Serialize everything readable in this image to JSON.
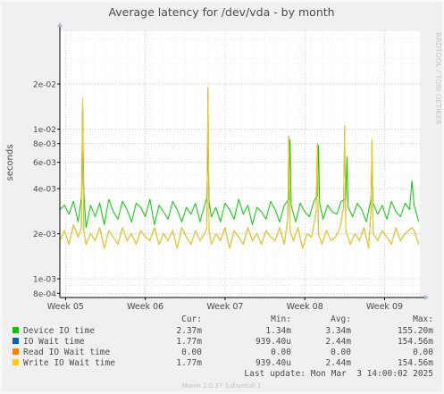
{
  "chart_data": {
    "type": "line",
    "title": "Average latency for /dev/vda - by month",
    "ylabel": "seconds",
    "watermark": "RRDTOOL / TOBI OETIKER",
    "yscale": "log",
    "ylim": [
      0.00075,
      0.045
    ],
    "xlim": [
      0,
      31.6
    ],
    "yticks": [
      {
        "v": 0.0008,
        "label": "8e-04"
      },
      {
        "v": 0.001,
        "label": "1e-03"
      },
      {
        "v": 0.002,
        "label": "2e-03"
      },
      {
        "v": 0.004,
        "label": "4e-03"
      },
      {
        "v": 0.006,
        "label": "6e-03"
      },
      {
        "v": 0.008,
        "label": "8e-03"
      },
      {
        "v": 0.01,
        "label": "1e-02"
      },
      {
        "v": 0.02,
        "label": "2e-02"
      }
    ],
    "xticks": [
      {
        "v": 0.5,
        "label": "Week 05"
      },
      {
        "v": 7.5,
        "label": "Week 06"
      },
      {
        "v": 14.5,
        "label": "Week 07"
      },
      {
        "v": 21.5,
        "label": "Week 08"
      },
      {
        "v": 28.5,
        "label": "Week 09"
      }
    ],
    "grid": true,
    "series": [
      {
        "name": "Device IO time",
        "color": "#00cc00",
        "x": [
          0,
          0.4,
          0.8,
          1.2,
          1.6,
          1.9,
          2.0,
          2.1,
          2.3,
          2.7,
          3.1,
          3.5,
          3.9,
          4.3,
          4.7,
          5.1,
          5.5,
          5.9,
          6.3,
          6.7,
          7.1,
          7.5,
          7.9,
          8.3,
          8.7,
          9.1,
          9.5,
          9.9,
          10.3,
          10.7,
          11.1,
          11.5,
          11.9,
          12.3,
          12.7,
          12.9,
          13.0,
          13.1,
          13.3,
          13.7,
          14.1,
          14.5,
          14.9,
          15.3,
          15.7,
          16.1,
          16.5,
          16.9,
          17.3,
          17.7,
          18.1,
          18.5,
          18.9,
          19.3,
          19.7,
          20.1,
          20.2,
          20.3,
          20.7,
          21.1,
          21.5,
          21.9,
          22.3,
          22.6,
          22.7,
          22.8,
          23.1,
          23.5,
          23.9,
          24.3,
          24.7,
          25.1,
          25.2,
          25.3,
          25.7,
          26.1,
          26.5,
          26.9,
          27.3,
          27.4,
          27.5,
          27.9,
          28.3,
          28.7,
          29.1,
          29.5,
          29.9,
          30.3,
          30.7,
          30.9,
          31.1,
          31.5
        ],
        "values": [
          0.0029,
          0.0031,
          0.0027,
          0.0033,
          0.0024,
          0.0035,
          0.015,
          0.0038,
          0.0022,
          0.0031,
          0.0026,
          0.0032,
          0.0023,
          0.0034,
          0.0028,
          0.0025,
          0.0033,
          0.0029,
          0.0024,
          0.0032,
          0.003,
          0.0026,
          0.0034,
          0.0023,
          0.0031,
          0.0028,
          0.0025,
          0.0033,
          0.0029,
          0.0024,
          0.003,
          0.0027,
          0.0032,
          0.0024,
          0.0031,
          0.0035,
          0.007,
          0.0033,
          0.0026,
          0.003,
          0.0024,
          0.0032,
          0.0029,
          0.0025,
          0.0034,
          0.0027,
          0.0031,
          0.0023,
          0.003,
          0.0028,
          0.0025,
          0.0033,
          0.0029,
          0.0024,
          0.0031,
          0.0034,
          0.0085,
          0.0031,
          0.0024,
          0.0032,
          0.0028,
          0.0026,
          0.0033,
          0.0036,
          0.0078,
          0.0032,
          0.0025,
          0.0031,
          0.0028,
          0.0027,
          0.0033,
          0.0034,
          0.0065,
          0.003,
          0.0026,
          0.0032,
          0.0029,
          0.0024,
          0.0034,
          0.006,
          0.0032,
          0.0027,
          0.0031,
          0.0025,
          0.0033,
          0.0028,
          0.0026,
          0.0032,
          0.0029,
          0.0045,
          0.0031,
          0.0024
        ]
      },
      {
        "name": "IO Wait time",
        "color": "#0066b3",
        "x": [
          0,
          0.4,
          0.8,
          1.2,
          1.6,
          1.9,
          2.0,
          2.1,
          2.3,
          2.7,
          3.1,
          3.5,
          3.9,
          4.3,
          4.7,
          5.1,
          5.5,
          5.9,
          6.3,
          6.7,
          7.1,
          7.5,
          7.9,
          8.3,
          8.7,
          9.1,
          9.5,
          9.9,
          10.3,
          10.7,
          11.1,
          11.5,
          11.9,
          12.3,
          12.7,
          12.9,
          13.0,
          13.1,
          13.3,
          13.7,
          14.1,
          14.5,
          14.9,
          15.3,
          15.7,
          16.1,
          16.5,
          16.9,
          17.3,
          17.7,
          18.1,
          18.5,
          18.9,
          19.3,
          19.7,
          20.0,
          20.1,
          20.2,
          20.5,
          20.9,
          21.3,
          21.7,
          22.1,
          22.5,
          22.6,
          22.7,
          23.0,
          23.4,
          23.8,
          24.2,
          24.6,
          24.9,
          25.0,
          25.1,
          25.5,
          25.9,
          26.3,
          26.7,
          27.1,
          27.3,
          27.4,
          27.5,
          27.9,
          28.3,
          28.7,
          29.1,
          29.5,
          29.9,
          30.3,
          30.9,
          31.1,
          31.5
        ],
        "values": [
          0.0018,
          0.0021,
          0.0017,
          0.0023,
          0.0019,
          0.0022,
          0.016,
          0.0021,
          0.0017,
          0.002,
          0.0018,
          0.0022,
          0.0016,
          0.0021,
          0.0019,
          0.0017,
          0.0022,
          0.0018,
          0.002,
          0.0017,
          0.0021,
          0.0019,
          0.0018,
          0.0022,
          0.0017,
          0.002,
          0.0018,
          0.0021,
          0.0016,
          0.0022,
          0.0019,
          0.0017,
          0.0021,
          0.0018,
          0.002,
          0.0022,
          0.019,
          0.0021,
          0.0017,
          0.002,
          0.0018,
          0.0022,
          0.0016,
          0.0021,
          0.0019,
          0.0017,
          0.0022,
          0.0018,
          0.002,
          0.0017,
          0.0021,
          0.0019,
          0.0018,
          0.0022,
          0.0017,
          0.0025,
          0.009,
          0.0021,
          0.0018,
          0.0022,
          0.0016,
          0.002,
          0.0019,
          0.0028,
          0.008,
          0.002,
          0.0017,
          0.0021,
          0.0018,
          0.0019,
          0.0022,
          0.003,
          0.0105,
          0.0021,
          0.0017,
          0.002,
          0.0018,
          0.0022,
          0.0016,
          0.0028,
          0.0085,
          0.002,
          0.0018,
          0.0021,
          0.0019,
          0.0017,
          0.0022,
          0.0018,
          0.002,
          0.0022,
          0.0021,
          0.0017
        ]
      },
      {
        "name": "Read IO Wait time",
        "color": "#ff8000",
        "x": [
          0,
          31.6
        ],
        "values": [
          0,
          0
        ]
      },
      {
        "name": "Write IO Wait time",
        "color": "#ffcc00",
        "x": [
          0,
          0.4,
          0.8,
          1.2,
          1.6,
          1.9,
          2.0,
          2.1,
          2.3,
          2.7,
          3.1,
          3.5,
          3.9,
          4.3,
          4.7,
          5.1,
          5.5,
          5.9,
          6.3,
          6.7,
          7.1,
          7.5,
          7.9,
          8.3,
          8.7,
          9.1,
          9.5,
          9.9,
          10.3,
          10.7,
          11.1,
          11.5,
          11.9,
          12.3,
          12.7,
          12.9,
          13.0,
          13.1,
          13.3,
          13.7,
          14.1,
          14.5,
          14.9,
          15.3,
          15.7,
          16.1,
          16.5,
          16.9,
          17.3,
          17.7,
          18.1,
          18.5,
          18.9,
          19.3,
          19.7,
          20.0,
          20.1,
          20.2,
          20.5,
          20.9,
          21.3,
          21.7,
          22.1,
          22.5,
          22.6,
          22.7,
          23.0,
          23.4,
          23.8,
          24.2,
          24.6,
          24.9,
          25.0,
          25.1,
          25.5,
          25.9,
          26.3,
          26.7,
          27.1,
          27.3,
          27.4,
          27.5,
          27.9,
          28.3,
          28.7,
          29.1,
          29.5,
          29.9,
          30.3,
          30.9,
          31.1,
          31.5
        ],
        "values": [
          0.0018,
          0.0021,
          0.0017,
          0.0023,
          0.0019,
          0.0022,
          0.016,
          0.0021,
          0.0017,
          0.002,
          0.0018,
          0.0022,
          0.0016,
          0.0021,
          0.0019,
          0.0017,
          0.0022,
          0.0018,
          0.002,
          0.0017,
          0.0021,
          0.0019,
          0.0018,
          0.0022,
          0.0017,
          0.002,
          0.0018,
          0.0021,
          0.0016,
          0.0022,
          0.0019,
          0.0017,
          0.0021,
          0.0018,
          0.002,
          0.0022,
          0.019,
          0.0021,
          0.0017,
          0.002,
          0.0018,
          0.0022,
          0.0016,
          0.0021,
          0.0019,
          0.0017,
          0.0022,
          0.0018,
          0.002,
          0.0017,
          0.0021,
          0.0019,
          0.0018,
          0.0022,
          0.0017,
          0.0025,
          0.009,
          0.0021,
          0.0018,
          0.0022,
          0.0016,
          0.002,
          0.0019,
          0.0028,
          0.008,
          0.002,
          0.0017,
          0.0021,
          0.0018,
          0.0019,
          0.0022,
          0.003,
          0.0105,
          0.0021,
          0.0017,
          0.002,
          0.0018,
          0.0022,
          0.0016,
          0.0028,
          0.0085,
          0.002,
          0.0018,
          0.0021,
          0.0019,
          0.0017,
          0.0022,
          0.0018,
          0.002,
          0.0022,
          0.0021,
          0.0017
        ]
      }
    ],
    "legend": {
      "headers": [
        "Cur:",
        "Min:",
        "Avg:",
        "Max:"
      ],
      "rows": [
        {
          "name": "Device IO time",
          "color": "#00cc00",
          "cur": "2.37m",
          "min": "1.34m",
          "avg": "3.34m",
          "max": "155.20m"
        },
        {
          "name": "IO Wait time",
          "color": "#0066b3",
          "cur": "1.77m",
          "min": "939.40u",
          "avg": "2.44m",
          "max": "154.56m"
        },
        {
          "name": "Read IO Wait time",
          "color": "#ff8000",
          "cur": "0.00",
          "min": "0.00",
          "avg": "0.00",
          "max": "0.00"
        },
        {
          "name": "Write IO Wait time",
          "color": "#ffcc00",
          "cur": "1.77m",
          "min": "939.40u",
          "avg": "2.44m",
          "max": "154.56m"
        }
      ]
    },
    "last_update": "Last update: Mon Mar  3 14:00:02 2025",
    "footer": "Munin 2.0.37-1ubuntu0.1"
  }
}
